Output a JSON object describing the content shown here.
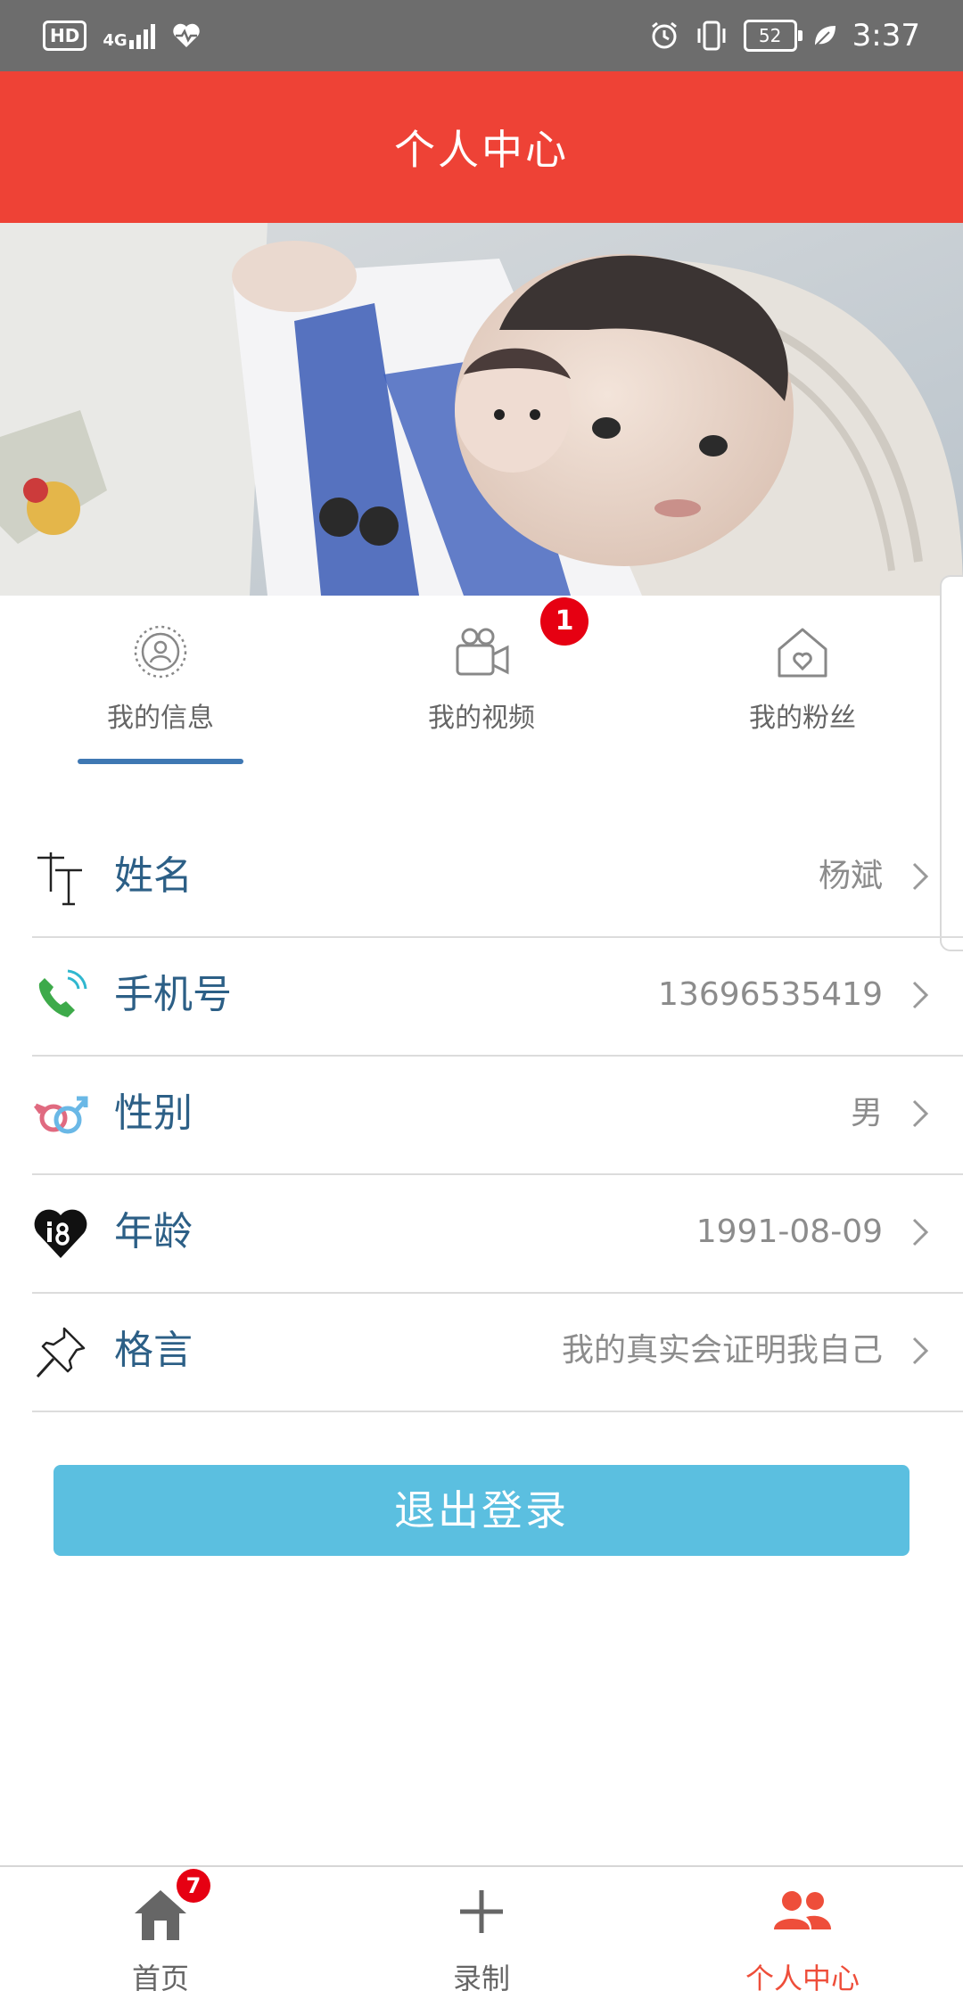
{
  "status_bar": {
    "hd": "HD",
    "network": "4G",
    "battery": "52",
    "time": "3:37"
  },
  "header": {
    "title": "个人中心"
  },
  "tabs": [
    {
      "label": "我的信息",
      "icon": "profile-icon",
      "active": true
    },
    {
      "label": "我的视频",
      "icon": "video-camera-icon",
      "badge": "1"
    },
    {
      "label": "我的粉丝",
      "icon": "house-heart-icon"
    }
  ],
  "info_rows": [
    {
      "label": "姓名",
      "value": "杨斌",
      "icon": "text-font-icon"
    },
    {
      "label": "手机号",
      "value": "13696535419",
      "icon": "phone-icon"
    },
    {
      "label": "性别",
      "value": "男",
      "icon": "gender-icon"
    },
    {
      "label": "年龄",
      "value": "1991-08-09",
      "icon": "heart-18-icon"
    },
    {
      "label": "格言",
      "value": "我的真实会证明我自己",
      "icon": "pushpin-icon"
    }
  ],
  "logout_label": "退出登录",
  "bottom_nav": [
    {
      "label": "首页",
      "icon": "home-icon",
      "badge": "7"
    },
    {
      "label": "录制",
      "icon": "plus-icon"
    },
    {
      "label": "个人中心",
      "icon": "users-icon",
      "active": true
    }
  ],
  "colors": {
    "header_bg": "#ee4236",
    "accent_blue": "#3f78b3",
    "logout_bg": "#5bbfe0",
    "active_nav": "#ee4e3a",
    "badge_red": "#e60012"
  }
}
